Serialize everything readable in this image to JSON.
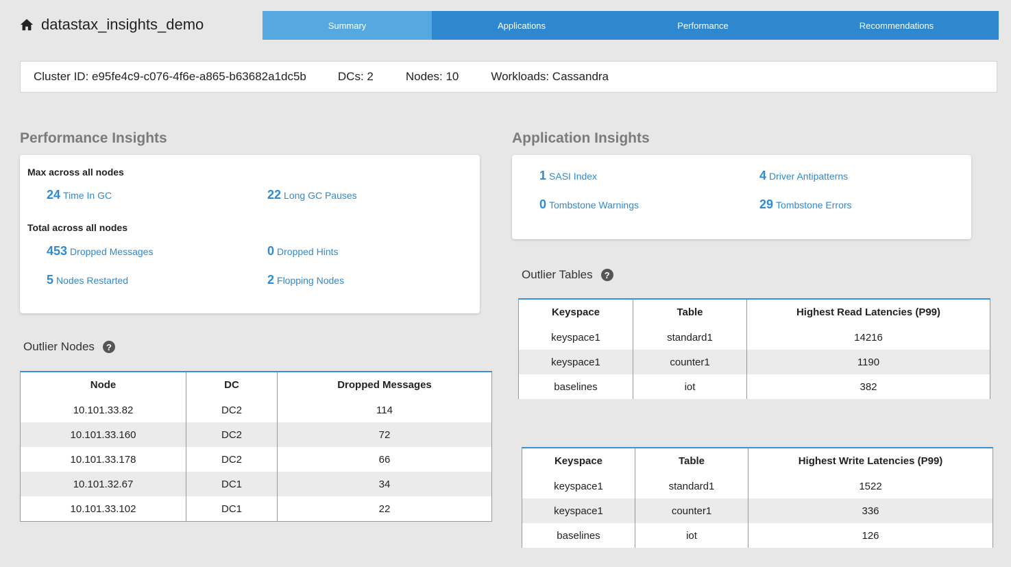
{
  "header": {
    "brand_icon": "home-icon",
    "title": "datastax_insights_demo",
    "tabs": [
      {
        "label": "Summary",
        "active": true
      },
      {
        "label": "Applications",
        "active": false
      },
      {
        "label": "Performance",
        "active": false
      },
      {
        "label": "Recommendations",
        "active": false
      }
    ],
    "colors": {
      "tab_bar": "#2f87cf",
      "tab_active": "#55a8e0"
    }
  },
  "cluster": {
    "id_label": "Cluster ID: e95fe4c9-c076-4f6e-a865-b63682a1dc5b",
    "dcs_label": "DCs: 2",
    "nodes_label": "Nodes: 10",
    "workloads_label": "Workloads: Cassandra"
  },
  "performance": {
    "title": "Performance Insights",
    "max_title": "Max across all nodes",
    "total_title": "Total across all nodes",
    "metrics": {
      "time_in_gc": {
        "value": "24",
        "label": "Time In GC"
      },
      "long_gc": {
        "value": "22",
        "label": "Long GC Pauses"
      },
      "dropped_messages": {
        "value": "453",
        "label": "Dropped Messages"
      },
      "dropped_hints": {
        "value": "0",
        "label": "Dropped Hints"
      },
      "nodes_restarted": {
        "value": "5",
        "label": "Nodes Restarted"
      },
      "flopping_nodes": {
        "value": "2",
        "label": "Flopping Nodes"
      }
    }
  },
  "application": {
    "title": "Application Insights",
    "metrics": {
      "sasi": {
        "value": "1",
        "label": "SASI Index"
      },
      "driver": {
        "value": "4",
        "label": "Driver Antipatterns"
      },
      "tomb_warn": {
        "value": "0",
        "label": "Tombstone Warnings"
      },
      "tomb_err": {
        "value": "29",
        "label": "Tombstone Errors"
      }
    }
  },
  "outlier_nodes": {
    "title": "Outlier Nodes",
    "headers": [
      "Node",
      "DC",
      "Dropped Messages"
    ],
    "rows": [
      [
        "10.101.33.82",
        "DC2",
        "114"
      ],
      [
        "10.101.33.160",
        "DC2",
        "72"
      ],
      [
        "10.101.33.178",
        "DC2",
        "66"
      ],
      [
        "10.101.32.67",
        "DC1",
        "34"
      ],
      [
        "10.101.33.102",
        "DC1",
        "22"
      ]
    ]
  },
  "outlier_tables": {
    "title": "Outlier Tables",
    "read": {
      "headers": [
        "Keyspace",
        "Table",
        "Highest Read Latencies (P99)"
      ],
      "rows": [
        [
          "keyspace1",
          "standard1",
          "14216"
        ],
        [
          "keyspace1",
          "counter1",
          "1190"
        ],
        [
          "baselines",
          "iot",
          "382"
        ]
      ]
    },
    "write": {
      "headers": [
        "Keyspace",
        "Table",
        "Highest Write Latencies (P99)"
      ],
      "rows": [
        [
          "keyspace1",
          "standard1",
          "1522"
        ],
        [
          "keyspace1",
          "counter1",
          "336"
        ],
        [
          "baselines",
          "iot",
          "126"
        ]
      ]
    }
  },
  "icons": {
    "help": "help-icon",
    "help_glyph": "?"
  },
  "accent_color": "#2d8ad3"
}
